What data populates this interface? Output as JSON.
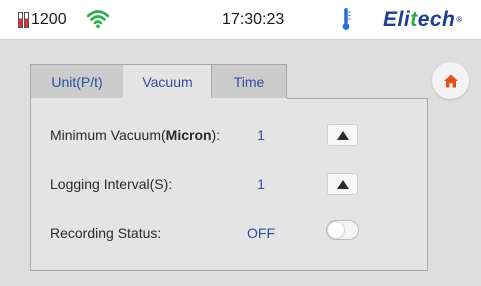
{
  "status_bar": {
    "model": "1200",
    "time": "17:30:23",
    "brand_prefix": "Eli",
    "brand_accent": "t",
    "brand_suffix": "ech",
    "brand_mark": "®",
    "icons": {
      "battery": "battery-low-icon",
      "wifi": "wifi-icon",
      "thermometer": "thermometer-icon"
    },
    "colors": {
      "wifi": "#27b14a",
      "thermometer": "#2c6fd0",
      "battery_low": "#e03030",
      "brand": "#1f3f8f",
      "brand_accent": "#2fa84a"
    }
  },
  "tabs": [
    {
      "label": "Unit(P/t)",
      "active": false
    },
    {
      "label": "Vacuum",
      "active": true
    },
    {
      "label": "Time",
      "active": false
    }
  ],
  "settings": {
    "min_vacuum": {
      "label_prefix": "Minimum Vacuum(",
      "label_unit": "Micron",
      "label_suffix": "):",
      "value": "1"
    },
    "logging_interval": {
      "label": "Logging Interval(S):",
      "value": "1"
    },
    "recording_status": {
      "label": "Recording Status:",
      "value": "OFF",
      "toggle_on": false
    }
  },
  "home": {
    "icon": "home-icon",
    "color": "#e0541c"
  },
  "accent_color": "#2d4ea0"
}
